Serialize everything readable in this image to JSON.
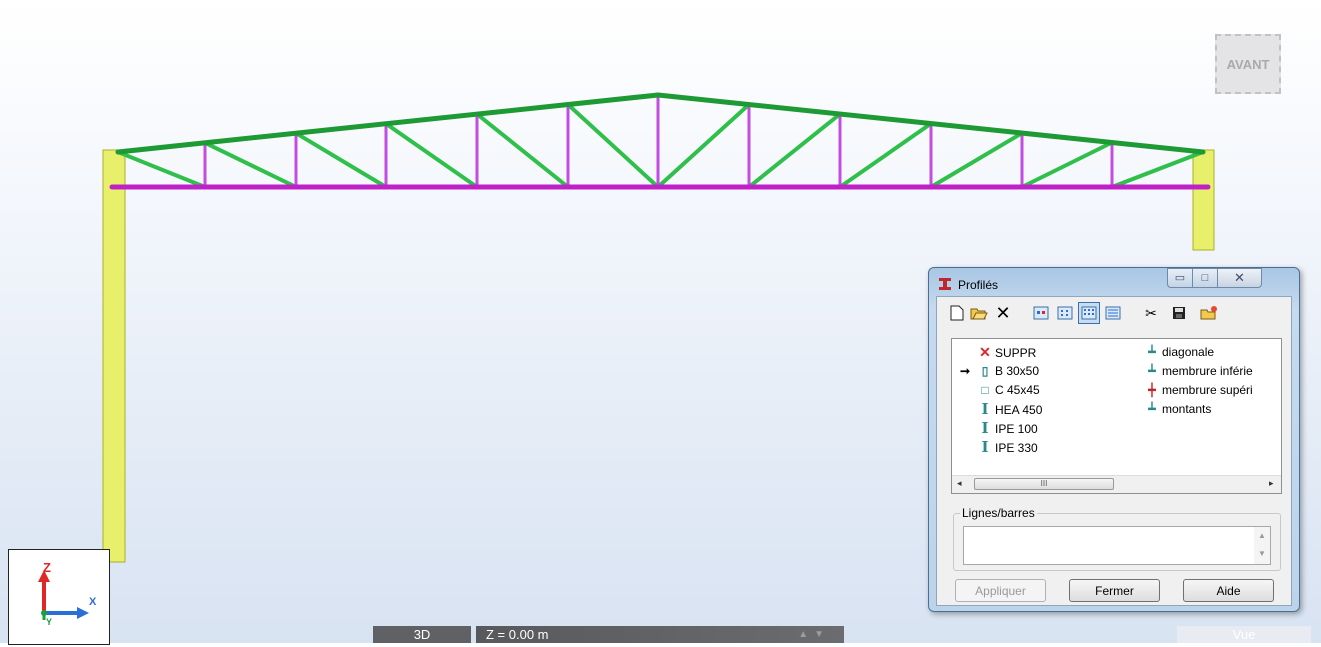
{
  "view": {
    "cube_label": "AVANT",
    "axis_z": "Z",
    "axis_x": "X",
    "axis_y": "Y",
    "bottom_bar": {
      "mode_tab": "3D",
      "z_level": "Z = 0.00 m",
      "view_tab": "Vue"
    }
  },
  "colors": {
    "diagonal": "#2fbf4a",
    "upper_chord": "#1e9a34",
    "vertical": "#c24de0",
    "lower_chord": "#c020c8",
    "column": "#e8ef6a"
  },
  "dialog": {
    "title": "Profilés",
    "window_buttons": {
      "minimize": "▭",
      "maximize": "□",
      "close": "✕"
    },
    "toolbar_icons": [
      "new-icon",
      "open-folder-icon",
      "delete-icon",
      "large-icons-view-icon",
      "small-icons-view-icon",
      "list-view-icon",
      "details-view-icon",
      "cut-icon",
      "save-icon",
      "folder-star-icon"
    ],
    "profiles": [
      {
        "label": "SUPPR",
        "icon": "delete-x-icon",
        "color": "#e0262d",
        "selected": false
      },
      {
        "label": "B 30x50",
        "icon": "rect-section-icon",
        "color": "#2a8a8a",
        "selected": true
      },
      {
        "label": "C 45x45",
        "icon": "square-section-icon",
        "color": "#2a8a8a",
        "selected": false
      },
      {
        "label": "HEA 450",
        "icon": "i-section-icon",
        "color": "#2a8a8a",
        "selected": false
      },
      {
        "label": "IPE 100",
        "icon": "i-section-icon",
        "color": "#2a8a8a",
        "selected": false
      },
      {
        "label": "IPE 330",
        "icon": "i-section-icon",
        "color": "#2a8a8a",
        "selected": false
      }
    ],
    "groups": [
      {
        "label": "diagonale",
        "icon": "tee-section-icon"
      },
      {
        "label": "membrure inférie",
        "icon": "tee-section-icon"
      },
      {
        "label": "membrure supéri",
        "icon": "cross-section-icon"
      },
      {
        "label": "montants",
        "icon": "tee-section-icon"
      }
    ],
    "scroll_thumb": "III",
    "lines_group_label": "Lignes/barres",
    "lines_value": "",
    "buttons": {
      "apply": "Appliquer",
      "close": "Fermer",
      "help": "Aide"
    }
  }
}
